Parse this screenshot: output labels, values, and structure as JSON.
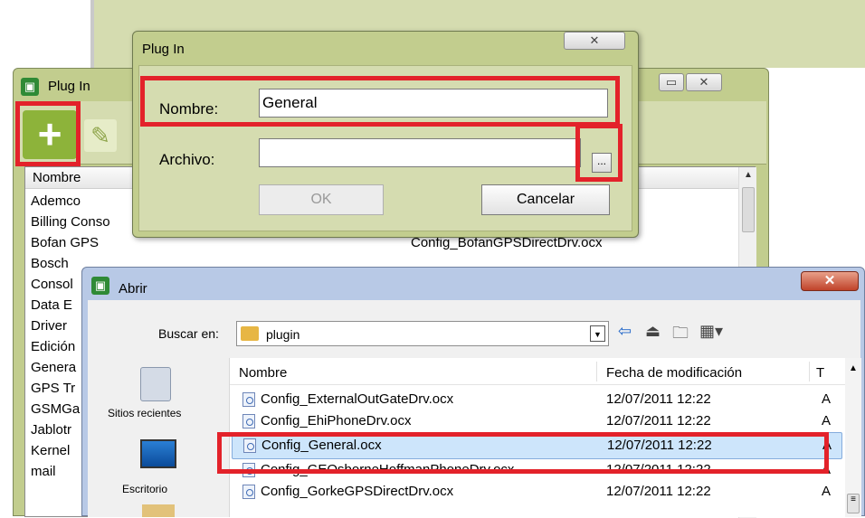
{
  "colors": {
    "olive": "#d5dcb0",
    "highlight": "#e3222a",
    "selection": "#cde5fb",
    "abrir_title": "#b8c9e6"
  },
  "main_window": {
    "title": "Plug In",
    "list_header": "Nombre",
    "rows_left": [
      "Ademco",
      "Billing Conso",
      "Bofan GPS",
      "Bosch",
      "Consol",
      "Data E",
      "Driver",
      "Edición",
      "Genera",
      "GPS Tr",
      "GSMGa",
      "Jablotr",
      "Kernel",
      "mail"
    ],
    "visible_file": "Config_BofanGPSDirectDrv.ocx"
  },
  "plugin_dialog": {
    "title": "Plug In",
    "nombre_label": "Nombre:",
    "nombre_value": "General",
    "archivo_label": "Archivo:",
    "archivo_value": "",
    "browse_label": "...",
    "ok_label": "OK",
    "cancel_label": "Cancelar"
  },
  "abrir_dialog": {
    "title": "Abrir",
    "buscar_label": "Buscar en:",
    "folder": "plugin",
    "sidebar": [
      {
        "label": "Sitios recientes",
        "icon": "recent-places-icon"
      },
      {
        "label": "Escritorio",
        "icon": "desktop-icon"
      }
    ],
    "columns": [
      "Nombre",
      "Fecha de modificación",
      "T"
    ],
    "files": [
      {
        "name": "Config_ExternalOutGateDrv.ocx",
        "date": "12/07/2011 12:22",
        "type": "A"
      },
      {
        "name": "Config_EhiPhoneDrv.ocx",
        "date": "12/07/2011 12:22",
        "type": "A"
      },
      {
        "name": "Config_General.ocx",
        "date": "12/07/2011 12:22",
        "type": "A"
      },
      {
        "name": "Config_GEOsborneHoffmanPhoneDrv.ocx",
        "date": "12/07/2011 12:22",
        "type": "A"
      },
      {
        "name": "Config_GorkeGPSDirectDrv.ocx",
        "date": "12/07/2011 12:22",
        "type": "A"
      }
    ]
  }
}
